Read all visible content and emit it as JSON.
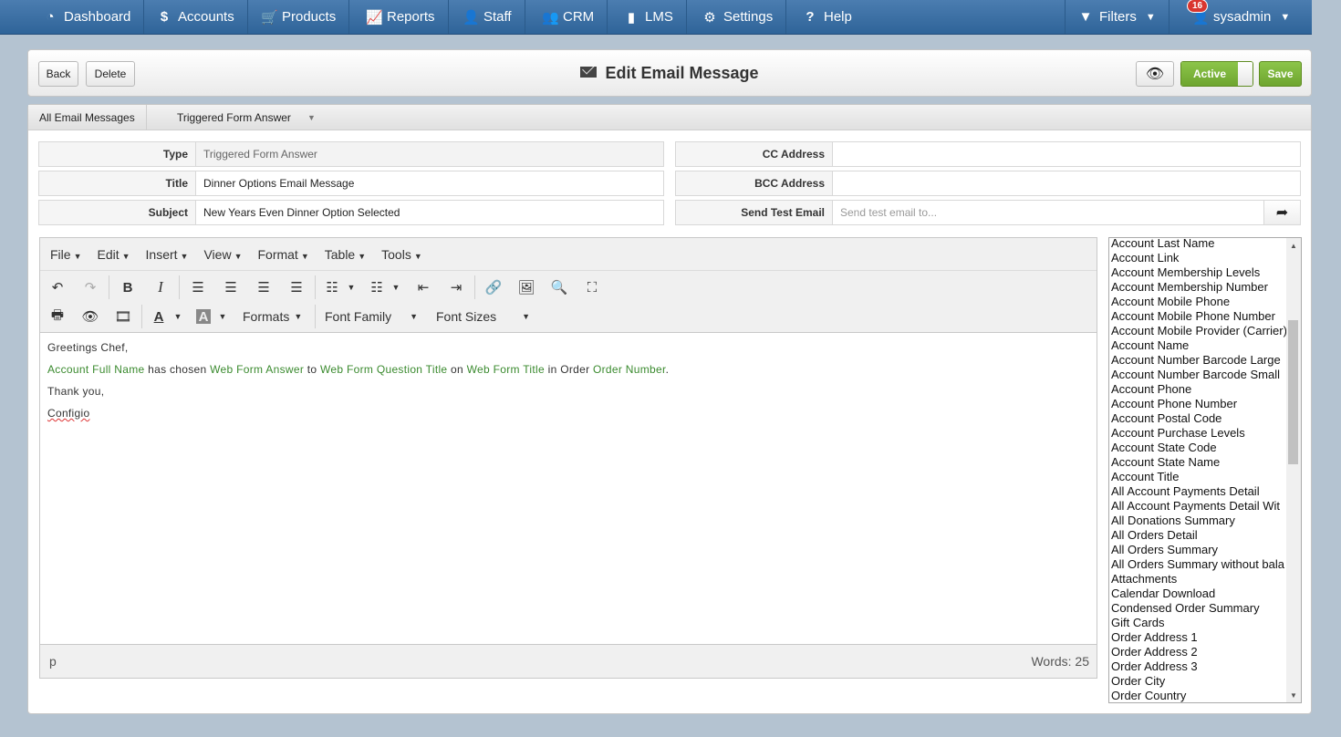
{
  "nav": {
    "left": [
      {
        "label": "Dashboard",
        "icon": "dashboard-icon"
      },
      {
        "label": "Accounts",
        "icon": "dollar-icon"
      },
      {
        "label": "Products",
        "icon": "cart-icon"
      },
      {
        "label": "Reports",
        "icon": "chart-icon"
      },
      {
        "label": "Staff",
        "icon": "user-icon"
      },
      {
        "label": "CRM",
        "icon": "users-icon"
      },
      {
        "label": "LMS",
        "icon": "book-icon"
      },
      {
        "label": "Settings",
        "icon": "gear-icon"
      },
      {
        "label": "Help",
        "icon": "question-icon"
      }
    ],
    "filters_label": "Filters",
    "user_label": "sysadmin",
    "notification_count": "16"
  },
  "header": {
    "back_label": "Back",
    "delete_label": "Delete",
    "title": "Edit Email Message",
    "active_label": "Active",
    "save_label": "Save"
  },
  "breadcrumb": {
    "root": "All Email Messages",
    "current": "Triggered Form Answer"
  },
  "form": {
    "type_label": "Type",
    "type_value": "Triggered Form Answer",
    "title_label": "Title",
    "title_value": "Dinner Options Email Message",
    "subject_label": "Subject",
    "subject_value": "New Years Even Dinner Option Selected",
    "cc_label": "CC Address",
    "cc_value": "",
    "bcc_label": "BCC Address",
    "bcc_value": "",
    "test_label": "Send Test Email",
    "test_placeholder": "Send test email to..."
  },
  "editor": {
    "menus": [
      "File",
      "Edit",
      "Insert",
      "View",
      "Format",
      "Table",
      "Tools"
    ],
    "formats_label": "Formats",
    "font_family_label": "Font Family",
    "font_sizes_label": "Font Sizes",
    "content": {
      "greeting": "Greetings Chef,",
      "t1": "Account Full Name",
      "w1": " has chosen ",
      "t2": "Web Form Answer",
      "w2": " to ",
      "t3": "Web Form Question Title",
      "w3": " on ",
      "t4": "Web Form Title",
      "w4": " in Order ",
      "t5": "Order Number",
      "w5": ".",
      "thanks": "Thank you,",
      "signature": "Configio"
    },
    "path": "p",
    "word_count": "Words: 25"
  },
  "field_list": [
    "Account Last Name",
    "Account Link",
    "Account Membership Levels",
    "Account Membership Number",
    "Account Mobile Phone",
    "Account Mobile Phone Number",
    "Account Mobile Provider (Carrier)",
    "Account Name",
    "Account Number Barcode Large",
    "Account Number Barcode Small",
    "Account Phone",
    "Account Phone Number",
    "Account Postal Code",
    "Account Purchase Levels",
    "Account State Code",
    "Account State Name",
    "Account Title",
    "All Account Payments Detail",
    "All Account Payments Detail Wit",
    "All Donations Summary",
    "All Orders Detail",
    "All Orders Summary",
    "All Orders Summary without bala",
    "Attachments",
    "Calendar Download",
    "Condensed Order Summary",
    "Gift Cards",
    "Order Address 1",
    "Order Address 2",
    "Order Address 3",
    "Order City",
    "Order Country"
  ],
  "colors": {
    "nav": "#2f6499",
    "accent_green": "#6ea530",
    "token_green": "#3a8a2e"
  }
}
